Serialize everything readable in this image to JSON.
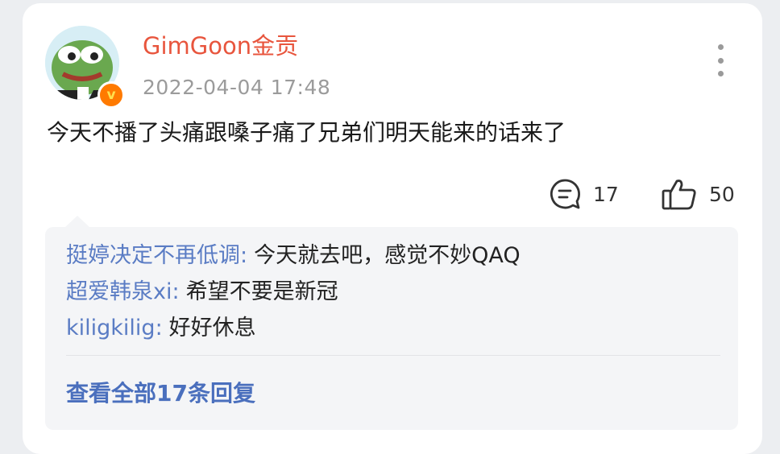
{
  "post": {
    "username": "GimGoon金贡",
    "timestamp": "2022-04-04  17:48",
    "badge_icon": "verified-v-badge",
    "text": "今天不播了头痛跟嗓子痛了兄弟们明天能来的话来了",
    "comment_count": "17",
    "like_count": "50"
  },
  "replies": [
    {
      "name": "挺婷决定不再低调",
      "colon": ":",
      "text": "今天就去吧，感觉不妙QAQ"
    },
    {
      "name": "超爱韩泉xi",
      "colon": ":",
      "text": "希望不要是新冠"
    },
    {
      "name": "kiligkilig",
      "colon": ":",
      "text": "好好休息"
    }
  ],
  "view_all_label": "查看全部17条回复",
  "colors": {
    "username": "#e8553d",
    "reply_name": "#5a7cc4",
    "link": "#4a6fbd",
    "badge": "#ff7a00"
  },
  "icons": [
    "more-vertical-icon",
    "comment-icon",
    "thumbs-up-icon"
  ]
}
